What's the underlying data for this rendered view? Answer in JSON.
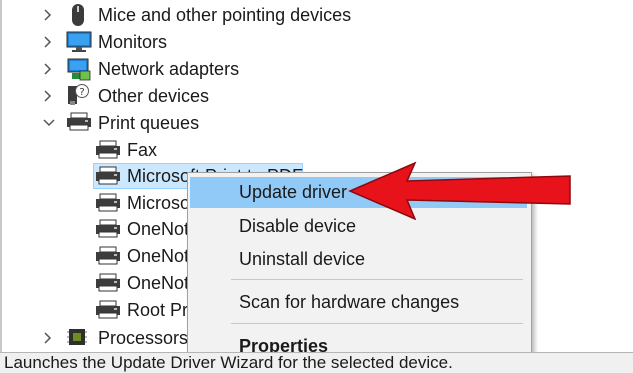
{
  "tree": {
    "items": [
      {
        "label": "Mice and other pointing devices",
        "icon": "mouse-icon"
      },
      {
        "label": "Monitors",
        "icon": "monitor-icon"
      },
      {
        "label": "Network adapters",
        "icon": "network-adapter-icon"
      },
      {
        "label": "Other devices",
        "icon": "unknown-device-icon"
      },
      {
        "label": "Print queues",
        "icon": "printer-icon"
      },
      {
        "label": "Fax",
        "icon": "printer-icon"
      },
      {
        "label": "Microsoft Print to PDF",
        "icon": "printer-icon"
      },
      {
        "label": "Microsoft XPS Document Writer",
        "icon": "printer-icon"
      },
      {
        "label": "OneNote",
        "icon": "printer-icon"
      },
      {
        "label": "OneNote",
        "icon": "printer-icon"
      },
      {
        "label": "OneNote",
        "icon": "printer-icon"
      },
      {
        "label": "Root Print Queue",
        "icon": "printer-icon"
      },
      {
        "label": "Processors",
        "icon": "processor-icon"
      }
    ]
  },
  "context_menu": {
    "items": [
      "Update driver",
      "Disable device",
      "Uninstall device",
      "Scan for hardware changes",
      "Properties"
    ],
    "highlighted": "Update driver"
  },
  "status_bar": {
    "text": "Launches the Update Driver Wizard for the selected device."
  },
  "colors": {
    "highlight": "#91c9f7",
    "selection": "#cce8ff",
    "arrow": "#e8121b"
  }
}
